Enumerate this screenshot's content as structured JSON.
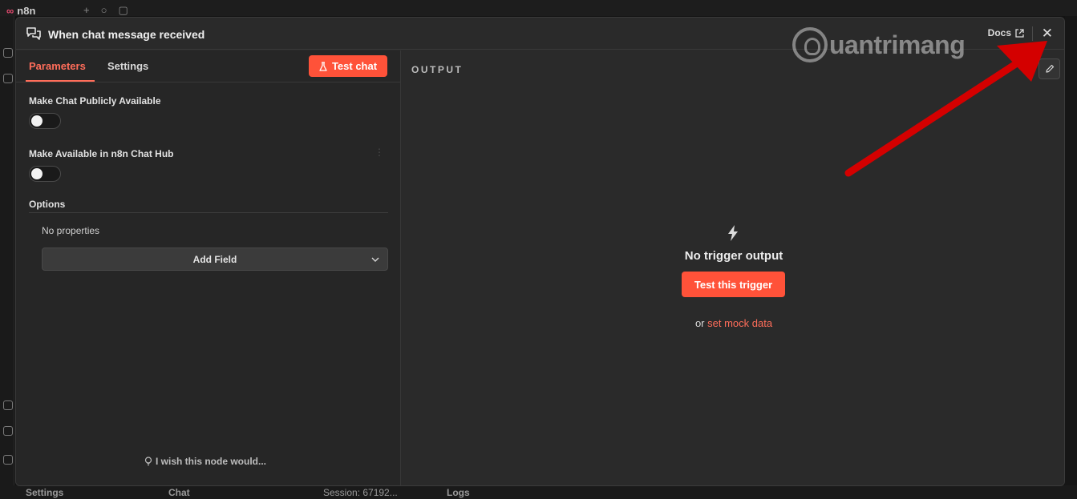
{
  "background_app": {
    "logo_text": "n8n",
    "bottom_bar": {
      "settings": "Settings",
      "chat": "Chat",
      "session": "Session: 67192...",
      "logs": "Logs"
    }
  },
  "modal": {
    "title": "When chat message received",
    "docs_label": "Docs",
    "close_glyph": "✕"
  },
  "left_panel": {
    "tabs": [
      {
        "label": "Parameters",
        "active": true
      },
      {
        "label": "Settings",
        "active": false
      }
    ],
    "test_chat_label": "Test chat",
    "fields": {
      "make_public_label": "Make Chat Publicly Available",
      "make_public_on": false,
      "chat_hub_label": "Make Available in n8n Chat Hub",
      "chat_hub_on": false
    },
    "options": {
      "heading": "Options",
      "empty_text": "No properties",
      "add_field_label": "Add Field"
    },
    "wish_label": "I wish this node would..."
  },
  "right_panel": {
    "output_label": "OUTPUT",
    "empty_title": "No trigger output",
    "test_trigger_label": "Test this trigger",
    "mock_prefix": "or",
    "mock_link": "set mock data"
  },
  "watermark": {
    "text": "uantrimang"
  },
  "colors": {
    "accent": "#ff6d5a",
    "button": "#ff5239",
    "annotation_arrow": "#d40000"
  }
}
